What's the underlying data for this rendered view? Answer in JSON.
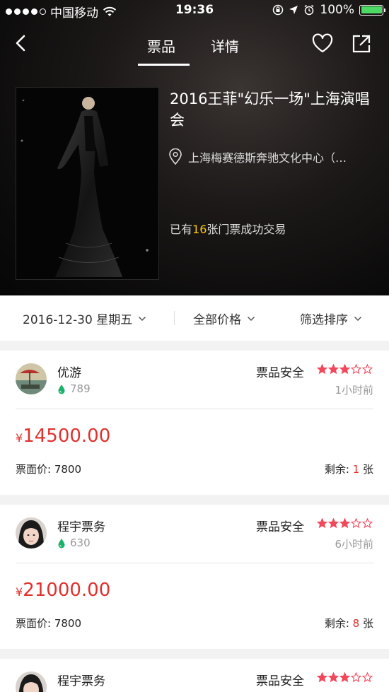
{
  "status_bar": {
    "carrier": "中国移动",
    "time": "19:36",
    "battery": "100%"
  },
  "nav": {
    "tabs": [
      {
        "label": "票品",
        "active": true
      },
      {
        "label": "详情",
        "active": false
      }
    ]
  },
  "event": {
    "title": "2016王菲\"幻乐一场\"上海演唱会",
    "venue": "上海梅赛德斯奔驰文化中心（…",
    "sold_prefix": "已有",
    "sold_count": "16",
    "sold_suffix": "张门票成功交易"
  },
  "filters": [
    {
      "label": "2016-12-30 星期五"
    },
    {
      "label": "全部价格"
    },
    {
      "label": "筛选排序"
    }
  ],
  "listings": [
    {
      "seller": "优游",
      "reputation": "789",
      "safety_label": "票品安全",
      "stars": 3,
      "stars_max": 5,
      "time_ago": "1小时前",
      "currency": "¥",
      "price": "14500.00",
      "face_label": "票面价: 7800",
      "remain_label": "剩余:",
      "remain_count": "1",
      "remain_unit": "张"
    },
    {
      "seller": "程宇票务",
      "reputation": "630",
      "safety_label": "票品安全",
      "stars": 3,
      "stars_max": 5,
      "time_ago": "6小时前",
      "currency": "¥",
      "price": "21000.00",
      "face_label": "票面价: 7800",
      "remain_label": "剩余:",
      "remain_count": "8",
      "remain_unit": "张"
    },
    {
      "seller": "程宇票务",
      "safety_label": "票品安全",
      "stars": 3,
      "stars_max": 5
    }
  ],
  "colors": {
    "accent_red": "#e0312d",
    "star_red": "#f2485b",
    "highlight_yellow": "#f5c518",
    "rep_green": "#19b36b"
  }
}
